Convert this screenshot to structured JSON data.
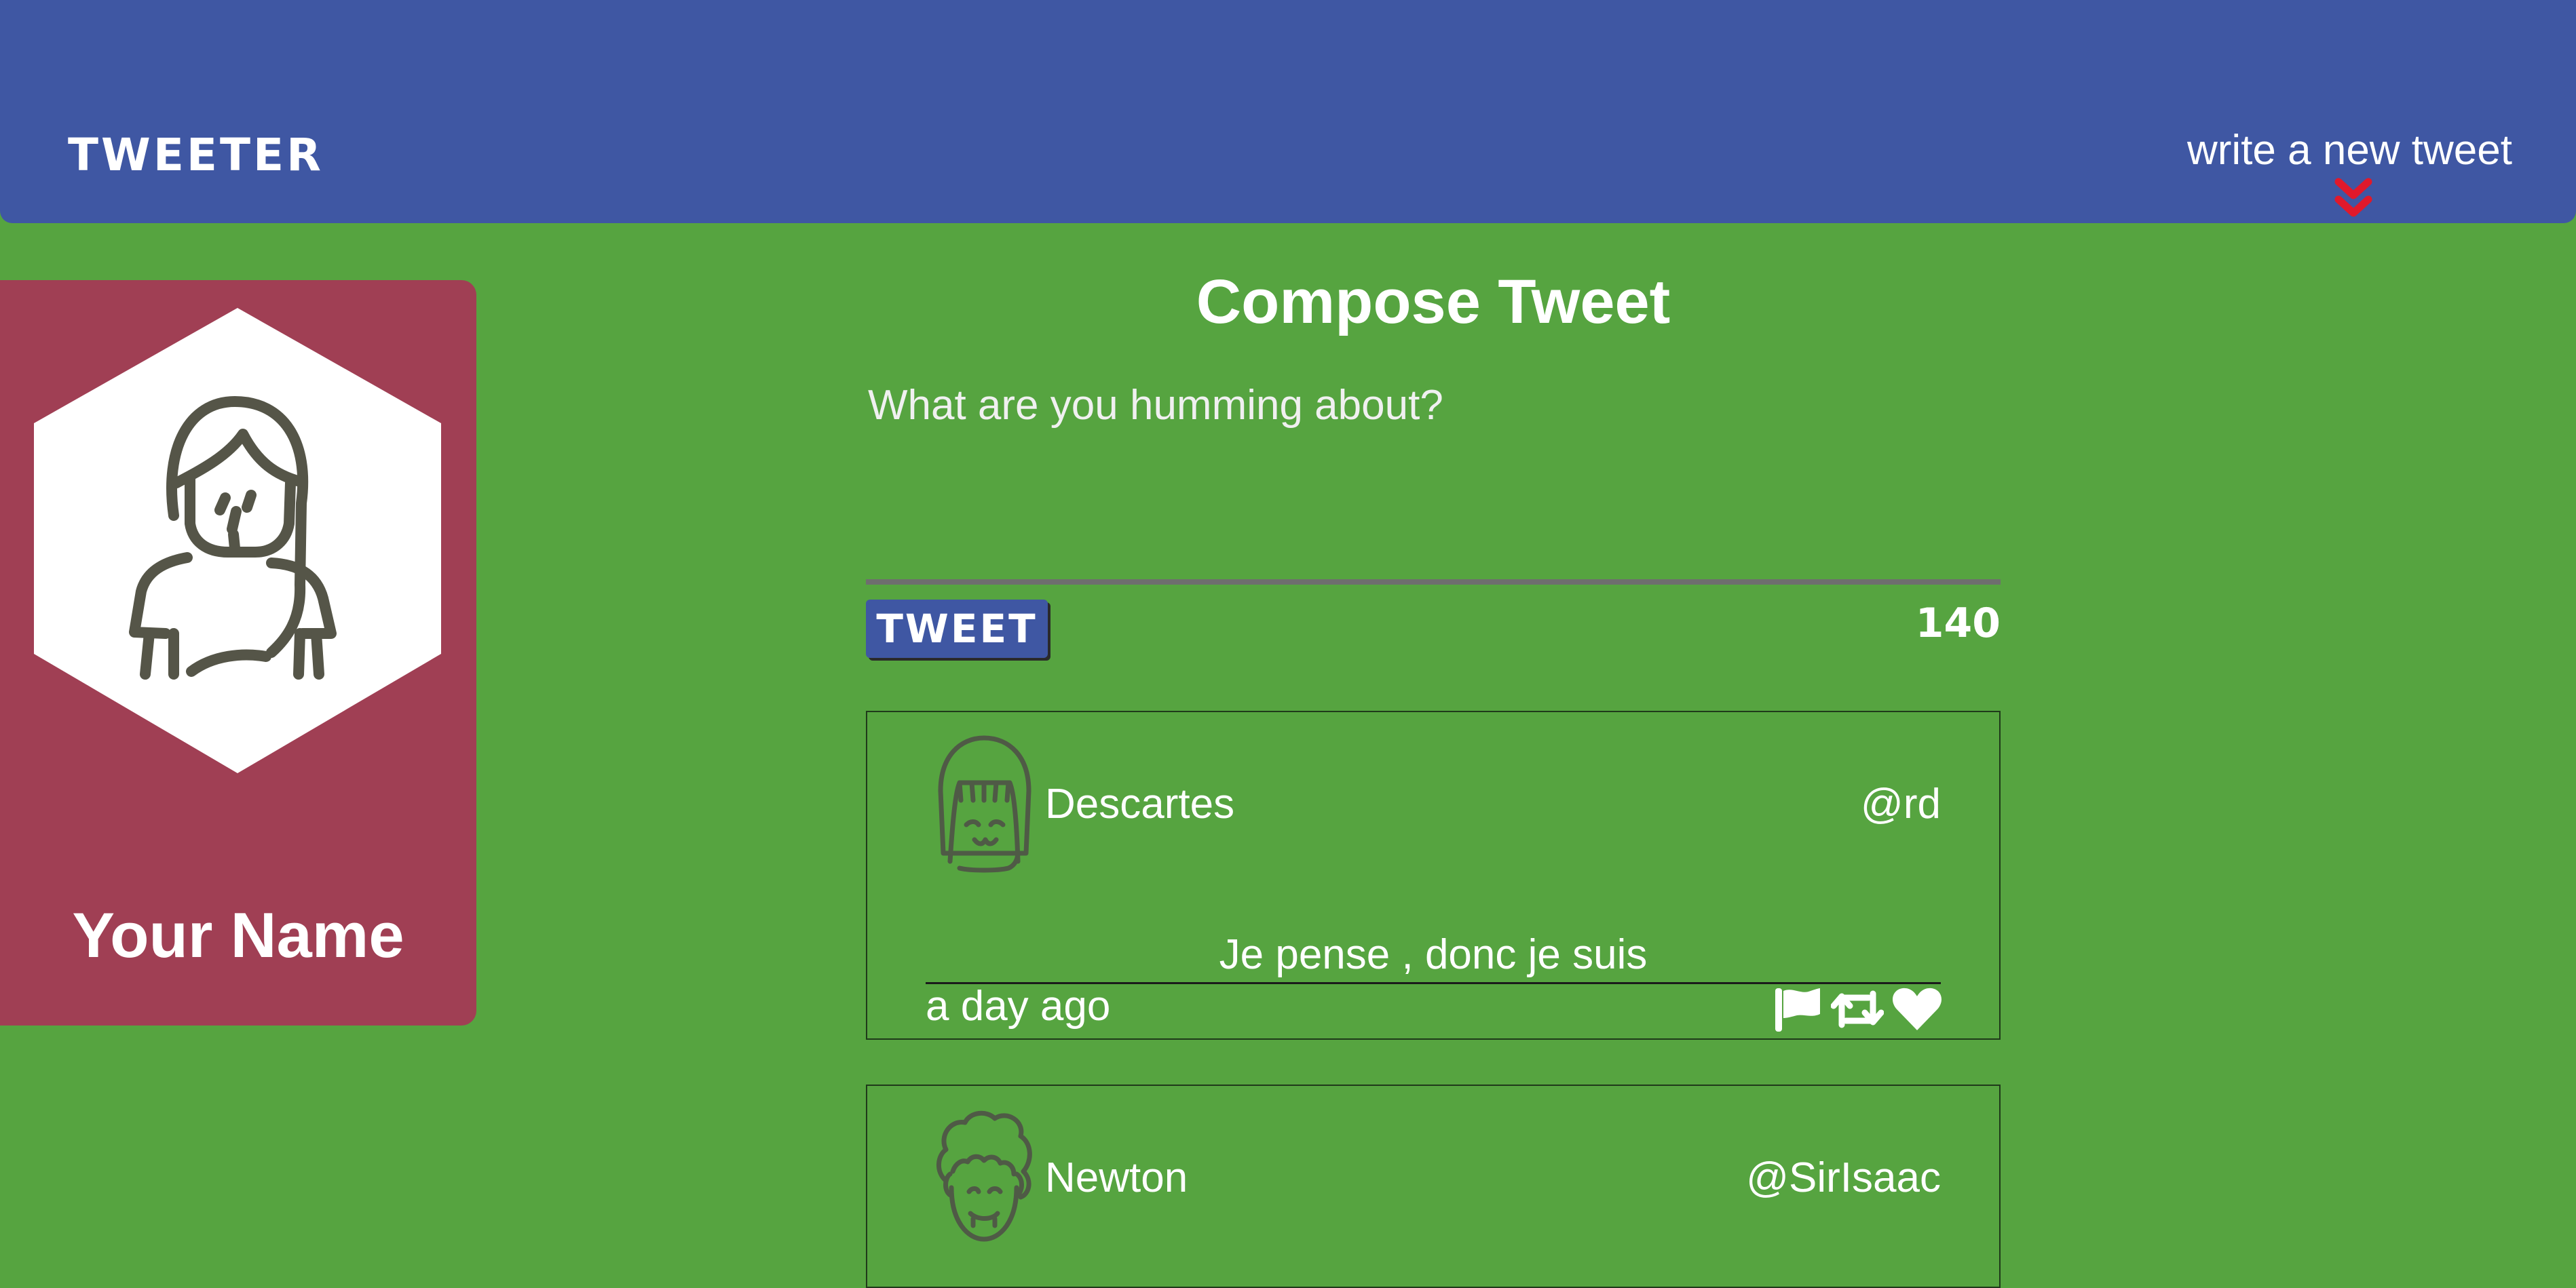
{
  "header": {
    "logo": "TWEETER",
    "write_link": "write a new tweet",
    "chevron_icon": "double-chevron-down-icon"
  },
  "profile": {
    "name": "Your Name",
    "avatar_icon": "woman-avatar-icon"
  },
  "compose": {
    "title": "Compose Tweet",
    "placeholder": "What are you humming about?",
    "button_label": "TWEET",
    "counter": "140"
  },
  "tweets": [
    {
      "name": "Descartes",
      "handle": "@rd",
      "text": "Je pense , donc je suis",
      "time": "a day ago",
      "avatar_icon": "girl-face-icon",
      "actions": [
        "flag-icon",
        "retweet-icon",
        "heart-icon"
      ]
    },
    {
      "name": "Newton",
      "handle": "@SirIsaac",
      "avatar_icon": "curly-hair-face-icon"
    }
  ],
  "colors": {
    "background": "#56a440",
    "header": "#3f57a3",
    "profile_card": "#a03f54",
    "chevron": "#e0192b"
  }
}
